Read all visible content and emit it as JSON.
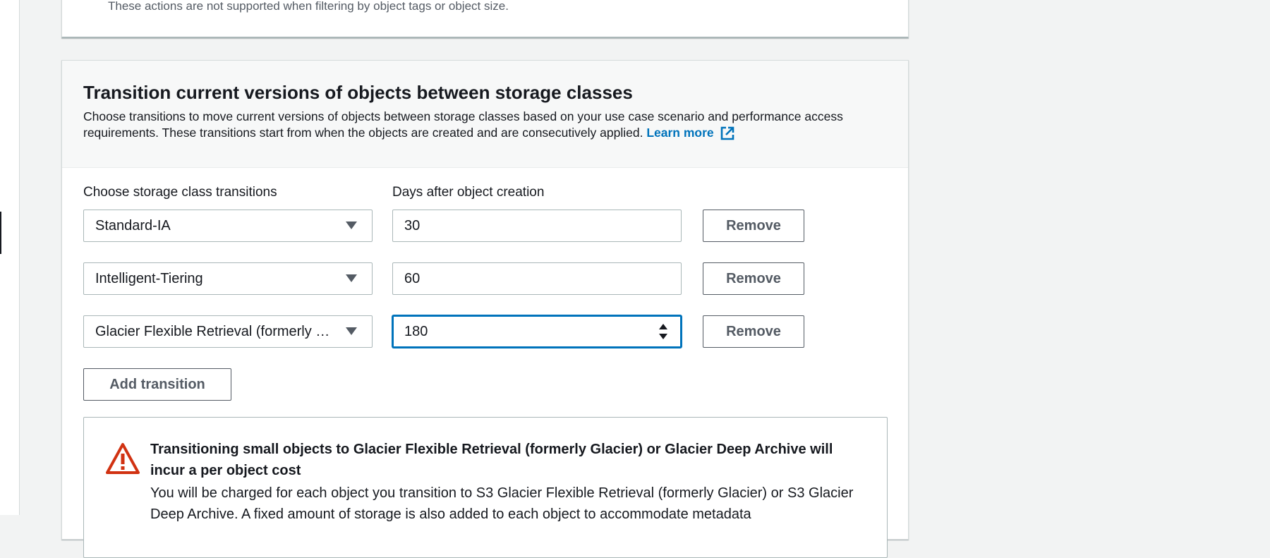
{
  "top_note": "These actions are not supported when filtering by object tags or object size.",
  "section": {
    "title": "Transition current versions of objects between storage classes",
    "description": "Choose transitions to move current versions of objects between storage classes based on your use case scenario and performance access requirements. These transitions start from when the objects are created and are consecutively applied.",
    "learn_more": "Learn more"
  },
  "labels": {
    "storage_class": "Choose storage class transitions",
    "days": "Days after object creation"
  },
  "transitions": [
    {
      "storage_class": "Standard-IA",
      "days": "30",
      "remove_label": "Remove"
    },
    {
      "storage_class": "Intelligent-Tiering",
      "days": "60",
      "remove_label": "Remove"
    },
    {
      "storage_class": "Glacier Flexible Retrieval (formerly Glacier)",
      "days": "180",
      "remove_label": "Remove"
    }
  ],
  "add_transition_label": "Add transition",
  "alert": {
    "title": "Transitioning small objects to Glacier Flexible Retrieval (formerly Glacier) or Glacier Deep Archive will incur a per object cost",
    "text": "You will be charged for each object you transition to S3 Glacier Flexible Retrieval (formerly Glacier) or S3 Glacier Deep Archive. A fixed amount of storage is also added to each object to accommodate metadata"
  },
  "colors": {
    "link": "#0073bb",
    "warning": "#d13212",
    "focus": "#0073bb"
  }
}
